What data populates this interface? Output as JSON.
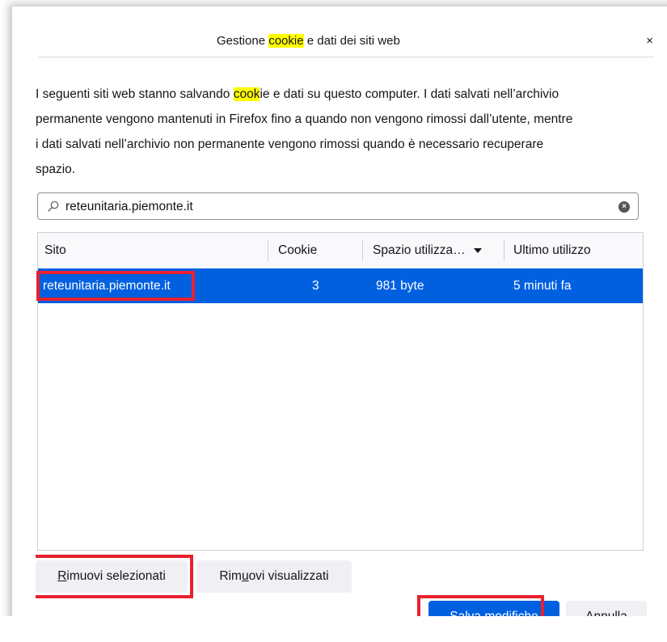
{
  "dialog": {
    "title_before": "Gestione ",
    "title_highlight": "cookie",
    "title_after": " e dati dei siti web",
    "close_glyph": "×"
  },
  "description": {
    "line1_before": "I seguenti siti web stanno salvando ",
    "line1_highlight": "cook",
    "line1_after": "ie e dati su questo computer. I dati salvati nell’archivio",
    "line2": "permanente vengono mantenuti in Firefox fino a quando non vengono rimossi dall’utente, mentre",
    "line3": "i dati salvati nell’archivio non permanente vengono rimossi quando è necessario recuperare",
    "line4": "spazio."
  },
  "search": {
    "value": "reteunitaria.piemonte.it",
    "icon": "search-icon",
    "clear_icon": "clear-icon"
  },
  "table": {
    "columns": [
      "Sito",
      "Cookie",
      "Spazio utilizza…",
      "Ultimo utilizzo"
    ],
    "rows": [
      {
        "site": "reteunitaria.piemonte.it",
        "cookies": "3",
        "storage": "981 byte",
        "last_used": "5 minuti fa"
      }
    ],
    "selected_color": "#0060df"
  },
  "buttons": {
    "remove_selected_prefix": "",
    "remove_selected_underline": "R",
    "remove_selected_rest": "imuovi selezionati",
    "remove_visible_prefix": "Rim",
    "remove_visible_underline": "u",
    "remove_visible_rest": "ovi visualizzati",
    "save": "Salva modifiche",
    "cancel": "Annulla"
  },
  "annotation_color": "#e8212f"
}
